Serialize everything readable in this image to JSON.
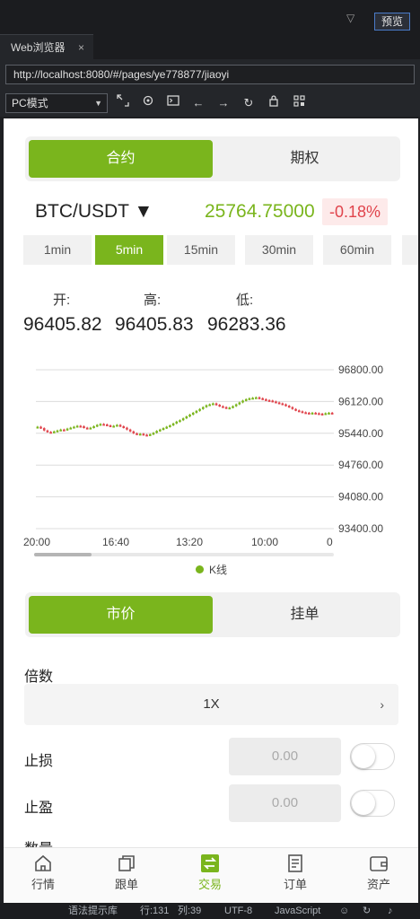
{
  "ide": {
    "preview_label": "预览",
    "tab_title": "Web浏览器",
    "tab_close": "×",
    "url": "http://localhost:8080/#/pages/ye778877/jiaoyi",
    "mode_select": "PC模式"
  },
  "app": {
    "top_tabs": [
      "合约",
      "期权"
    ],
    "pair": "BTC/USDT ▼",
    "price": "25764.75000",
    "change": "-0.18%",
    "intervals": [
      "1min",
      "5min",
      "15min",
      "30min",
      "60min"
    ],
    "ohl": {
      "labels": [
        "开:",
        "高:",
        "低:"
      ],
      "values": [
        "96405.82",
        "96405.83",
        "96283.36"
      ]
    },
    "legend": "K线",
    "order_tabs": [
      "市价",
      "挂单"
    ],
    "multiplier_label": "倍数",
    "multiplier_value": "1X",
    "multiplier_arrow": "›",
    "stop_loss_label": "止损",
    "stop_loss_value": "0.00",
    "take_profit_label": "止盈",
    "take_profit_value": "0.00",
    "quantity_label": "数量",
    "nav": [
      "行情",
      "跟单",
      "交易",
      "订单",
      "资产"
    ]
  },
  "chart_data": {
    "type": "candlestick",
    "y_ticks": [
      "96800.00",
      "96120.00",
      "95440.00",
      "94760.00",
      "94080.00",
      "93400.00"
    ],
    "ylim": [
      93400,
      96800
    ],
    "x_ticks": [
      "20:00",
      "16:40",
      "13:20",
      "10:00",
      "0"
    ],
    "series": [
      {
        "name": "K线",
        "values": [
          95580,
          95550,
          95500,
          95470,
          95460,
          95480,
          95500,
          95520,
          95510,
          95540,
          95560,
          95580,
          95600,
          95590,
          95560,
          95540,
          95560,
          95590,
          95620,
          95640,
          95630,
          95610,
          95590,
          95600,
          95620,
          95590,
          95560,
          95520,
          95480,
          95440,
          95420,
          95430,
          95410,
          95400,
          95420,
          95450,
          95490,
          95520,
          95550,
          95580,
          95610,
          95650,
          95690,
          95720,
          95760,
          95800,
          95840,
          95880,
          95920,
          95960,
          96000,
          96040,
          96060,
          96080,
          96050,
          96020,
          96000,
          95980,
          95990,
          96020,
          96060,
          96100,
          96140,
          96170,
          96190,
          96200,
          96210,
          96190,
          96170,
          96150,
          96140,
          96120,
          96100,
          96080,
          96060,
          96030,
          96000,
          95960,
          95930,
          95910,
          95890,
          95880,
          95870,
          95880,
          95870,
          95860,
          95850,
          95870,
          95880,
          95870
        ]
      }
    ]
  },
  "status": {
    "hint": "语法提示库",
    "line": "行:131",
    "col": "列:39",
    "encoding": "UTF-8",
    "lang": "JavaScript"
  },
  "colors": {
    "accent": "#7ab51d",
    "down": "#e0444c"
  }
}
